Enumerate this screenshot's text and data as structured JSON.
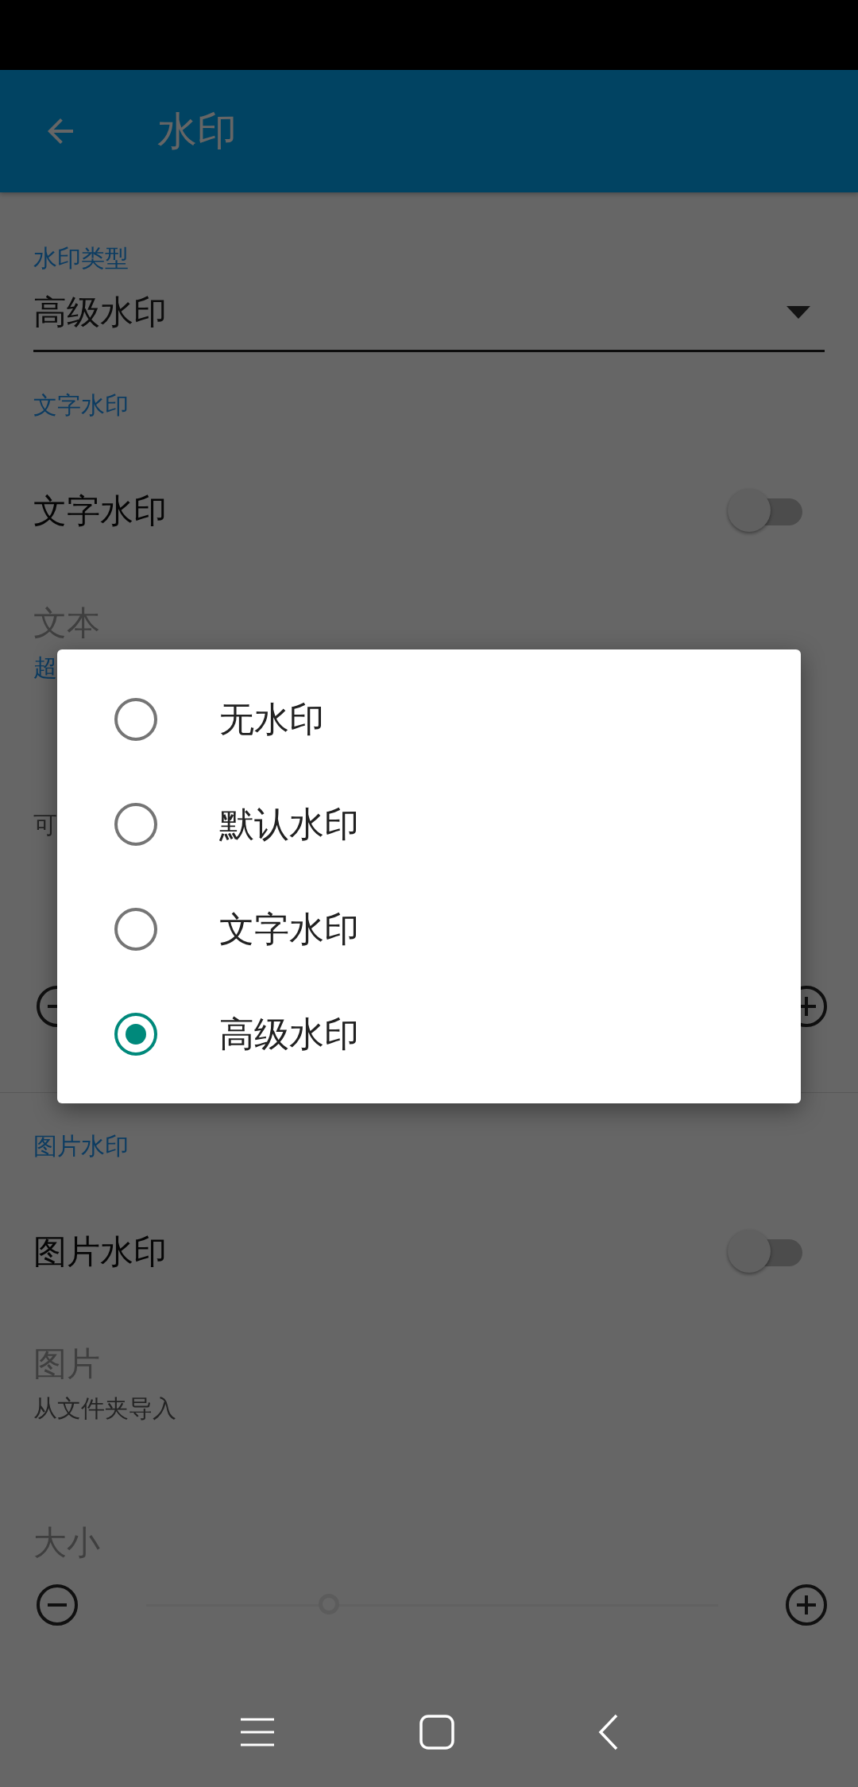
{
  "app_bar": {
    "title": "水印"
  },
  "settings": [
    {
      "kind": "caption",
      "text": "水印类型"
    },
    {
      "kind": "dropdown",
      "value": "高级水印"
    },
    {
      "kind": "header",
      "text": "文字水印"
    },
    {
      "kind": "switch",
      "title": "文字水印",
      "on": false
    },
    {
      "kind": "text",
      "title": "文本",
      "summary": "超",
      "summary_accent": true,
      "disabled": true
    },
    {
      "kind": "text",
      "summary": "可",
      "summary_accent": false,
      "disabled": true
    },
    {
      "kind": "slider"
    },
    {
      "kind": "header",
      "text": "图片水印"
    },
    {
      "kind": "switch",
      "title": "图片水印",
      "on": false
    },
    {
      "kind": "text",
      "title": "图片",
      "summary": "从文件夹导入",
      "summary_accent": false,
      "disabled": true
    },
    {
      "kind": "slider",
      "title": "大小",
      "level": 0.32,
      "disabled": true
    }
  ],
  "dialog": {
    "options": [
      {
        "label": "无水印",
        "selected": false
      },
      {
        "label": "默认水印",
        "selected": false
      },
      {
        "label": "文字水印",
        "selected": false
      },
      {
        "label": "高级水印",
        "selected": true
      }
    ]
  }
}
